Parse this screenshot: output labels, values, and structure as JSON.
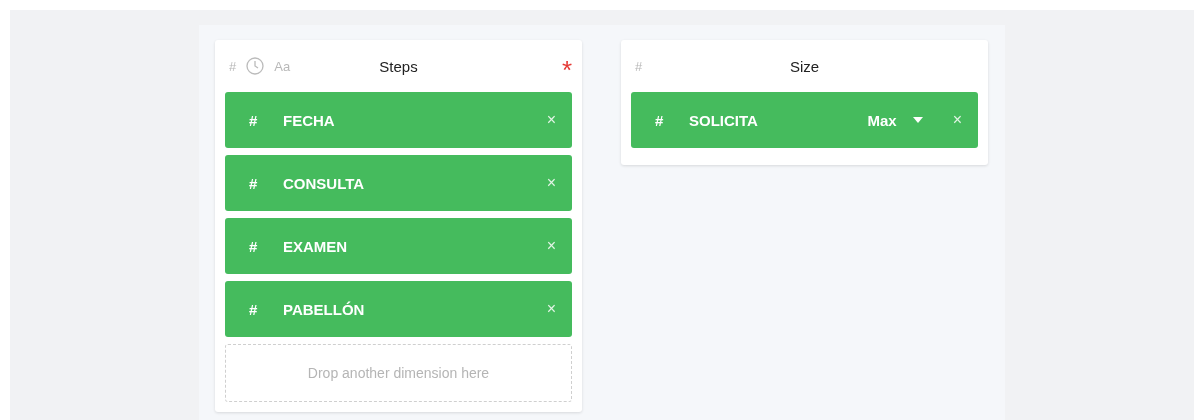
{
  "panels": [
    {
      "title": "Steps",
      "type_filters": [
        {
          "kind": "glyph",
          "label": "#"
        },
        {
          "kind": "clock"
        },
        {
          "kind": "glyph",
          "label": "Aa"
        }
      ],
      "required_mark": "*",
      "fields": [
        {
          "type_glyph": "#",
          "name": "FECHA",
          "remove": "×"
        },
        {
          "type_glyph": "#",
          "name": "CONSULTA",
          "remove": "×"
        },
        {
          "type_glyph": "#",
          "name": "EXAMEN",
          "remove": "×"
        },
        {
          "type_glyph": "#",
          "name": "PABELLÓN",
          "remove": "×"
        }
      ],
      "drop_hint": "Drop another dimension here"
    },
    {
      "title": "Size",
      "type_filters": [
        {
          "kind": "glyph",
          "label": "#"
        }
      ],
      "fields": [
        {
          "type_glyph": "#",
          "name": "SOLICITA",
          "aggregate": "Max",
          "remove": "×"
        }
      ]
    }
  ]
}
